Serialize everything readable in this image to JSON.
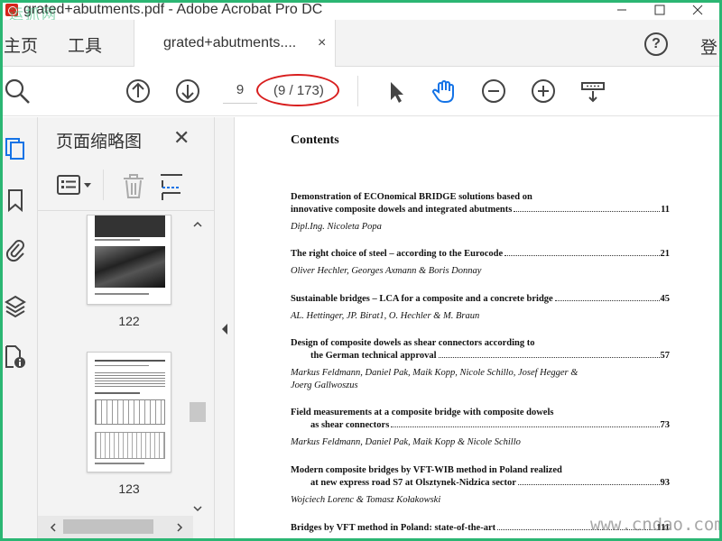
{
  "window": {
    "title": "grated+abutments.pdf - Adobe Acrobat Pro DC",
    "watermark": "运抓网"
  },
  "menu": {
    "home": "主页",
    "tools": "工具",
    "login": "登"
  },
  "tab": {
    "label": "grated+abutments....",
    "close": "×"
  },
  "toolbar": {
    "page_value": "9",
    "page_total": "(9 / 173)"
  },
  "panel": {
    "title": "页面缩略图",
    "close": "✕",
    "thumbnails": [
      {
        "label": "122"
      },
      {
        "label": "123"
      }
    ]
  },
  "document": {
    "heading": "Contents",
    "entries": [
      {
        "title_line1": "Demonstration of ECOnomical BRIDGE solutions based on",
        "title_line2": "innovative composite dowels and integrated abutments",
        "page": "11",
        "authors": "Dipl.Ing. Nicoleta Popa"
      },
      {
        "title_line1": "The right choice of steel – according to the Eurocode",
        "page": "21",
        "authors": "Oliver Hechler, Georges Axmann & Boris Donnay"
      },
      {
        "title_line1": "Sustainable bridges – LCA for a composite and a concrete bridge",
        "page": "45",
        "authors": "AL. Hettinger, JP. Birat1, O. Hechler & M. Braun"
      },
      {
        "title_line1": "Design of composite dowels as shear connectors according to",
        "title_line2": "the German technical approval",
        "page": "57",
        "authors": "Markus Feldmann, Daniel Pak, Maik Kopp, Nicole Schillo, Josef Hegger &",
        "authors2": "Joerg Gallwoszus"
      },
      {
        "title_line1": "Field measurements at a composite bridge with composite dowels",
        "title_line2": "as shear connectors",
        "page": "73",
        "authors": "Markus Feldmann, Daniel Pak, Maik Kopp & Nicole Schillo"
      },
      {
        "title_line1": "Modern composite bridges by VFT-WIB method in Poland realized",
        "title_line2": "at new express road S7 at Olsztynek-Nidzica sector",
        "page": "93",
        "authors": "Wojciech Lorenc & Tomasz Kołakowski"
      },
      {
        "title_line1": "Bridges by VFT method in Poland: state-of-the-art",
        "page": "111"
      }
    ]
  },
  "site_watermark": "www.cndao.com",
  "colors": {
    "accent": "#1473e6",
    "frame": "#2bb673",
    "highlight": "#d81e1e"
  }
}
